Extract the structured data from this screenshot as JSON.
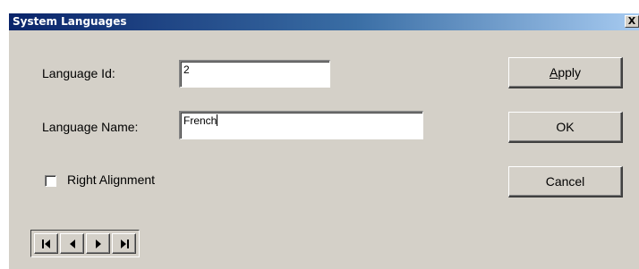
{
  "window": {
    "title": "System Languages",
    "close_glyph": "X"
  },
  "form": {
    "language_id_label": "Language Id:",
    "language_id_value": "2",
    "language_name_label": "Language Name:",
    "language_name_value": "French",
    "right_alignment_label": "Right Alignment",
    "right_alignment_checked": false
  },
  "buttons": {
    "apply_underlined_letter": "A",
    "apply_rest": "pply",
    "ok_label": "OK",
    "cancel_label": "Cancel"
  },
  "navigator": {
    "icons": [
      "first-record-icon",
      "previous-record-icon",
      "next-record-icon",
      "last-record-icon"
    ]
  },
  "colors": {
    "face": "#d4d0c8",
    "title_start": "#0a246a",
    "title_end": "#a6caf0"
  }
}
